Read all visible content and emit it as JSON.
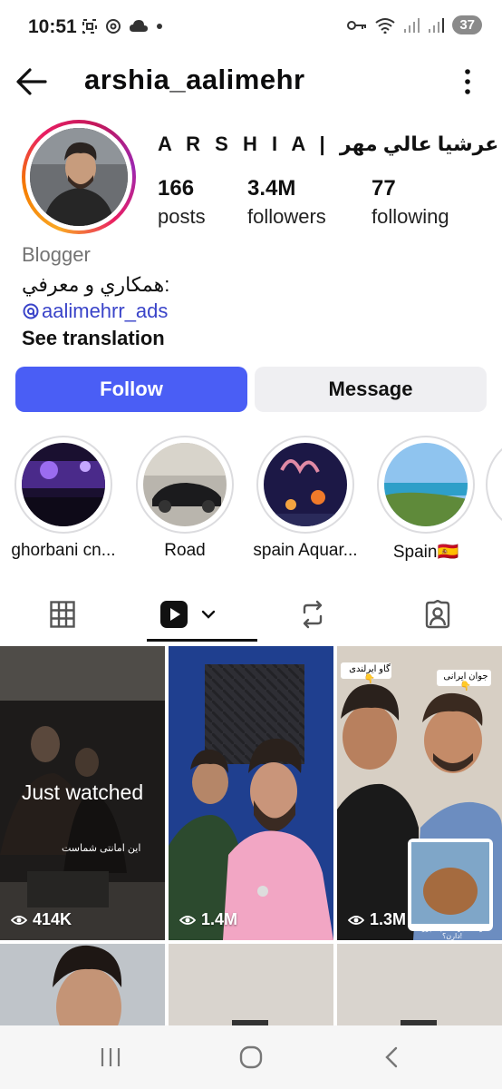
{
  "status_bar": {
    "time": "10:51",
    "battery": "37",
    "icons": [
      "screenshot-icon",
      "threads-icon",
      "cloud-icon",
      "dot-icon",
      "key-icon",
      "wifi-icon",
      "signal-icon",
      "signal-icon"
    ]
  },
  "header": {
    "username": "arshia_aalimehr",
    "back_icon": "arrow-left-icon",
    "more_icon": "more-vertical-icon"
  },
  "profile": {
    "display_name": "A R S H I A |  عرشيا عالي مهر",
    "stats": [
      {
        "value": "166",
        "label": "posts"
      },
      {
        "value": "3.4M",
        "label": "followers"
      },
      {
        "value": "77",
        "label": "following"
      }
    ],
    "category": "Blogger",
    "bio": "همكاري و معرفي:",
    "threads_handle": "aalimehrr_ads",
    "see_translation": "See translation"
  },
  "actions": {
    "follow": "Follow",
    "message": "Message"
  },
  "highlights": [
    {
      "label": "ghorbani cn..."
    },
    {
      "label": "Road"
    },
    {
      "label": "spain Aquar..."
    },
    {
      "label": "Spain🇪🇸"
    }
  ],
  "tabs": [
    {
      "icon": "grid-icon",
      "selected": false
    },
    {
      "icon": "reels-icon",
      "selected": true
    },
    {
      "icon": "repost-icon",
      "selected": false
    },
    {
      "icon": "tagged-icon",
      "selected": false
    }
  ],
  "reels": [
    {
      "views": "414K",
      "overlay": "Just watched",
      "caption": "این امانتی شماست"
    },
    {
      "views": "1.4M"
    },
    {
      "views": "1.3M",
      "caption_left": "گاو ایرلندی👇",
      "caption_right": "جوان ایرانی👇",
      "caption_bottom": "گاوهای ایرلندی پاسپورت دارن؟!"
    }
  ],
  "colors": {
    "accent": "#4a5ef5",
    "link": "#3a44c9",
    "secondary_button": "#efeff2"
  },
  "navbar": {
    "icons": [
      "recent-apps-icon",
      "home-icon",
      "back-icon"
    ]
  }
}
